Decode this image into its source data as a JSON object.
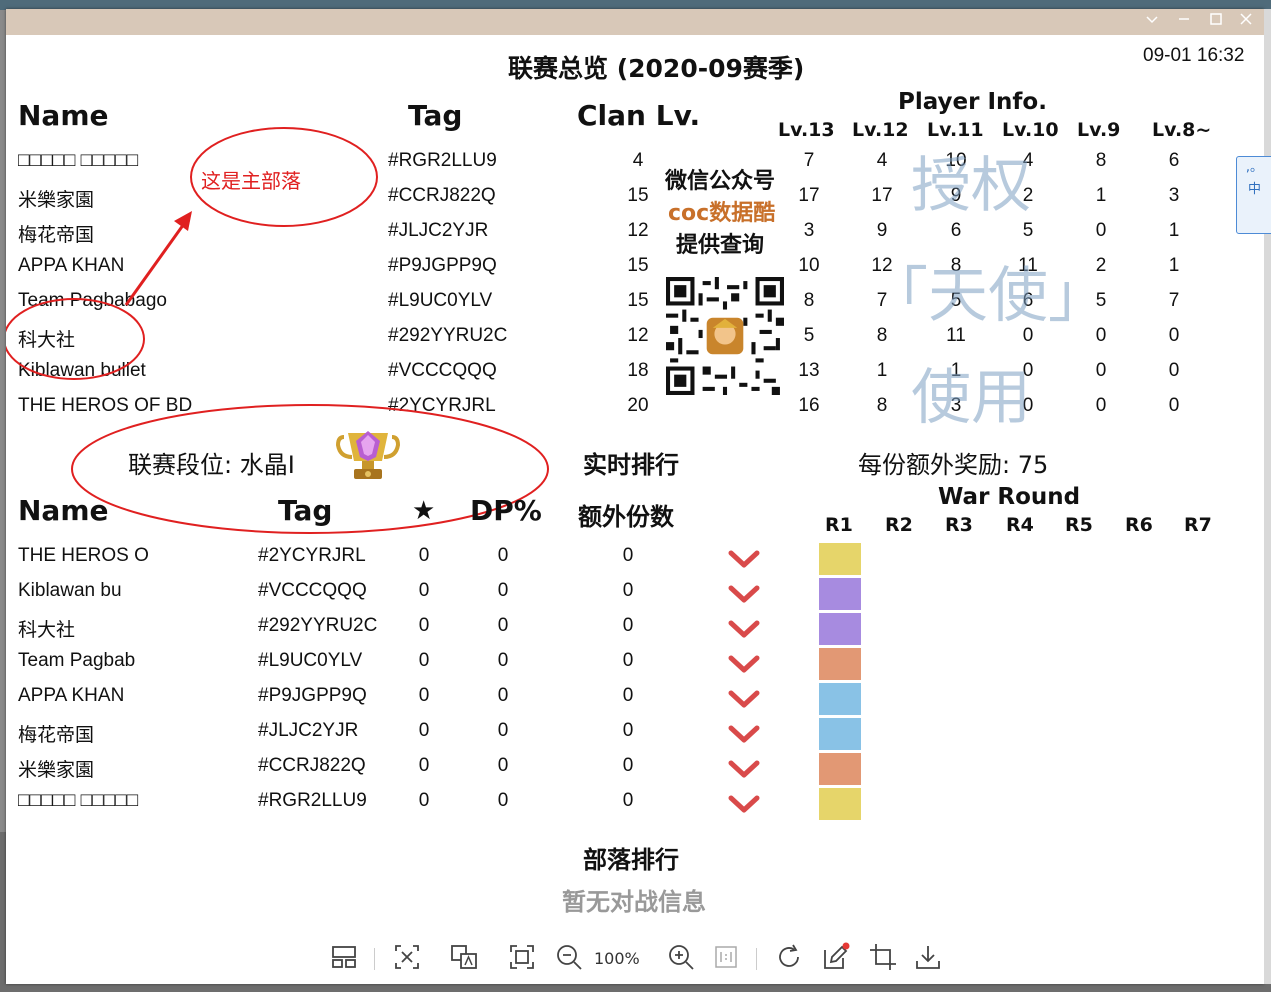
{
  "window": {
    "clock": "09-01 16:32"
  },
  "main_title": "联赛总览 (2020-09赛季)",
  "top_headers": {
    "name": "Name",
    "tag": "Tag",
    "clan_lv": "Clan Lv.",
    "player_info": "Player Info."
  },
  "level_headers": [
    "Lv.13",
    "Lv.12",
    "Lv.11",
    "Lv.10",
    "Lv.9",
    "Lv.8~"
  ],
  "clans": [
    {
      "name": "□□□□□ □□□□□",
      "tag": "#RGR2LLU9",
      "lv": "4",
      "levels": [
        "7",
        "4",
        "10",
        "4",
        "8",
        "6"
      ]
    },
    {
      "name": "米樂家園",
      "tag": "#CCRJ822Q",
      "lv": "15",
      "levels": [
        "17",
        "17",
        "9",
        "2",
        "1",
        "3"
      ]
    },
    {
      "name": "梅花帝国",
      "tag": "#JLJC2YJR",
      "lv": "12",
      "levels": [
        "3",
        "9",
        "6",
        "5",
        "0",
        "1"
      ]
    },
    {
      "name": "APPA KHAN",
      "tag": "#P9JGPP9Q",
      "lv": "15",
      "levels": [
        "10",
        "12",
        "8",
        "11",
        "2",
        "1"
      ]
    },
    {
      "name": "Team Pagbabago",
      "tag": "#L9UC0YLV",
      "lv": "15",
      "levels": [
        "8",
        "7",
        "5",
        "6",
        "5",
        "7"
      ]
    },
    {
      "name": "科大社",
      "tag": "#292YYRU2C",
      "lv": "12",
      "levels": [
        "5",
        "8",
        "11",
        "0",
        "0",
        "0"
      ]
    },
    {
      "name": "Kiblawan bullet",
      "tag": "#VCCCQQQ",
      "lv": "18",
      "levels": [
        "13",
        "1",
        "1",
        "0",
        "0",
        "0"
      ]
    },
    {
      "name": "THE HEROS OF BD",
      "tag": "#2YCYRJRL",
      "lv": "20",
      "levels": [
        "16",
        "8",
        "3",
        "0",
        "0",
        "0"
      ]
    }
  ],
  "promo": {
    "line1": "微信公众号",
    "line2": "coc数据酷",
    "line3": "提供查询"
  },
  "watermark": [
    "授权",
    "「天使」",
    "使用"
  ],
  "annotations": {
    "main_clan_note": "这是主部落"
  },
  "league": {
    "label": "联赛段位: 水晶I",
    "realtime_label": "实时排行",
    "bonus_label": "每份额外奖励: 75"
  },
  "bottom_headers": {
    "name": "Name",
    "tag": "Tag",
    "star": "★",
    "dp": "DP%",
    "extra": "额外份数",
    "war_round": "War Round"
  },
  "rounds": [
    "R1",
    "R2",
    "R3",
    "R4",
    "R5",
    "R6",
    "R7"
  ],
  "ranking": [
    {
      "name": "THE HEROS O",
      "tag": "#2YCYRJRL",
      "stars": "0",
      "dp": "0",
      "extra": "0",
      "color": "#e6d56a"
    },
    {
      "name": "Kiblawan bu",
      "tag": "#VCCCQQQ",
      "stars": "0",
      "dp": "0",
      "extra": "0",
      "color": "#a78be0"
    },
    {
      "name": "科大社",
      "tag": "#292YYRU2C",
      "stars": "0",
      "dp": "0",
      "extra": "0",
      "color": "#a78be0"
    },
    {
      "name": "Team Pagbab",
      "tag": "#L9UC0YLV",
      "stars": "0",
      "dp": "0",
      "extra": "0",
      "color": "#e29874"
    },
    {
      "name": "APPA KHAN",
      "tag": "#P9JGPP9Q",
      "stars": "0",
      "dp": "0",
      "extra": "0",
      "color": "#89c2e6"
    },
    {
      "name": "梅花帝国",
      "tag": "#JLJC2YJR",
      "stars": "0",
      "dp": "0",
      "extra": "0",
      "color": "#89c2e6"
    },
    {
      "name": "米樂家園",
      "tag": "#CCRJ822Q",
      "stars": "0",
      "dp": "0",
      "extra": "0",
      "color": "#e29874"
    },
    {
      "name": "□□□□□ □□□□□",
      "tag": "#RGR2LLU9",
      "stars": "0",
      "dp": "0",
      "extra": "0",
      "color": "#e6d56a"
    }
  ],
  "clan_rank": {
    "title": "部落排行",
    "empty": "暂无对战信息"
  },
  "toolbar": {
    "zoom": "100%"
  },
  "colors": {
    "accent_red": "#d94a4a",
    "promo_orange": "#c8702a",
    "annotation_red": "#e02020"
  }
}
